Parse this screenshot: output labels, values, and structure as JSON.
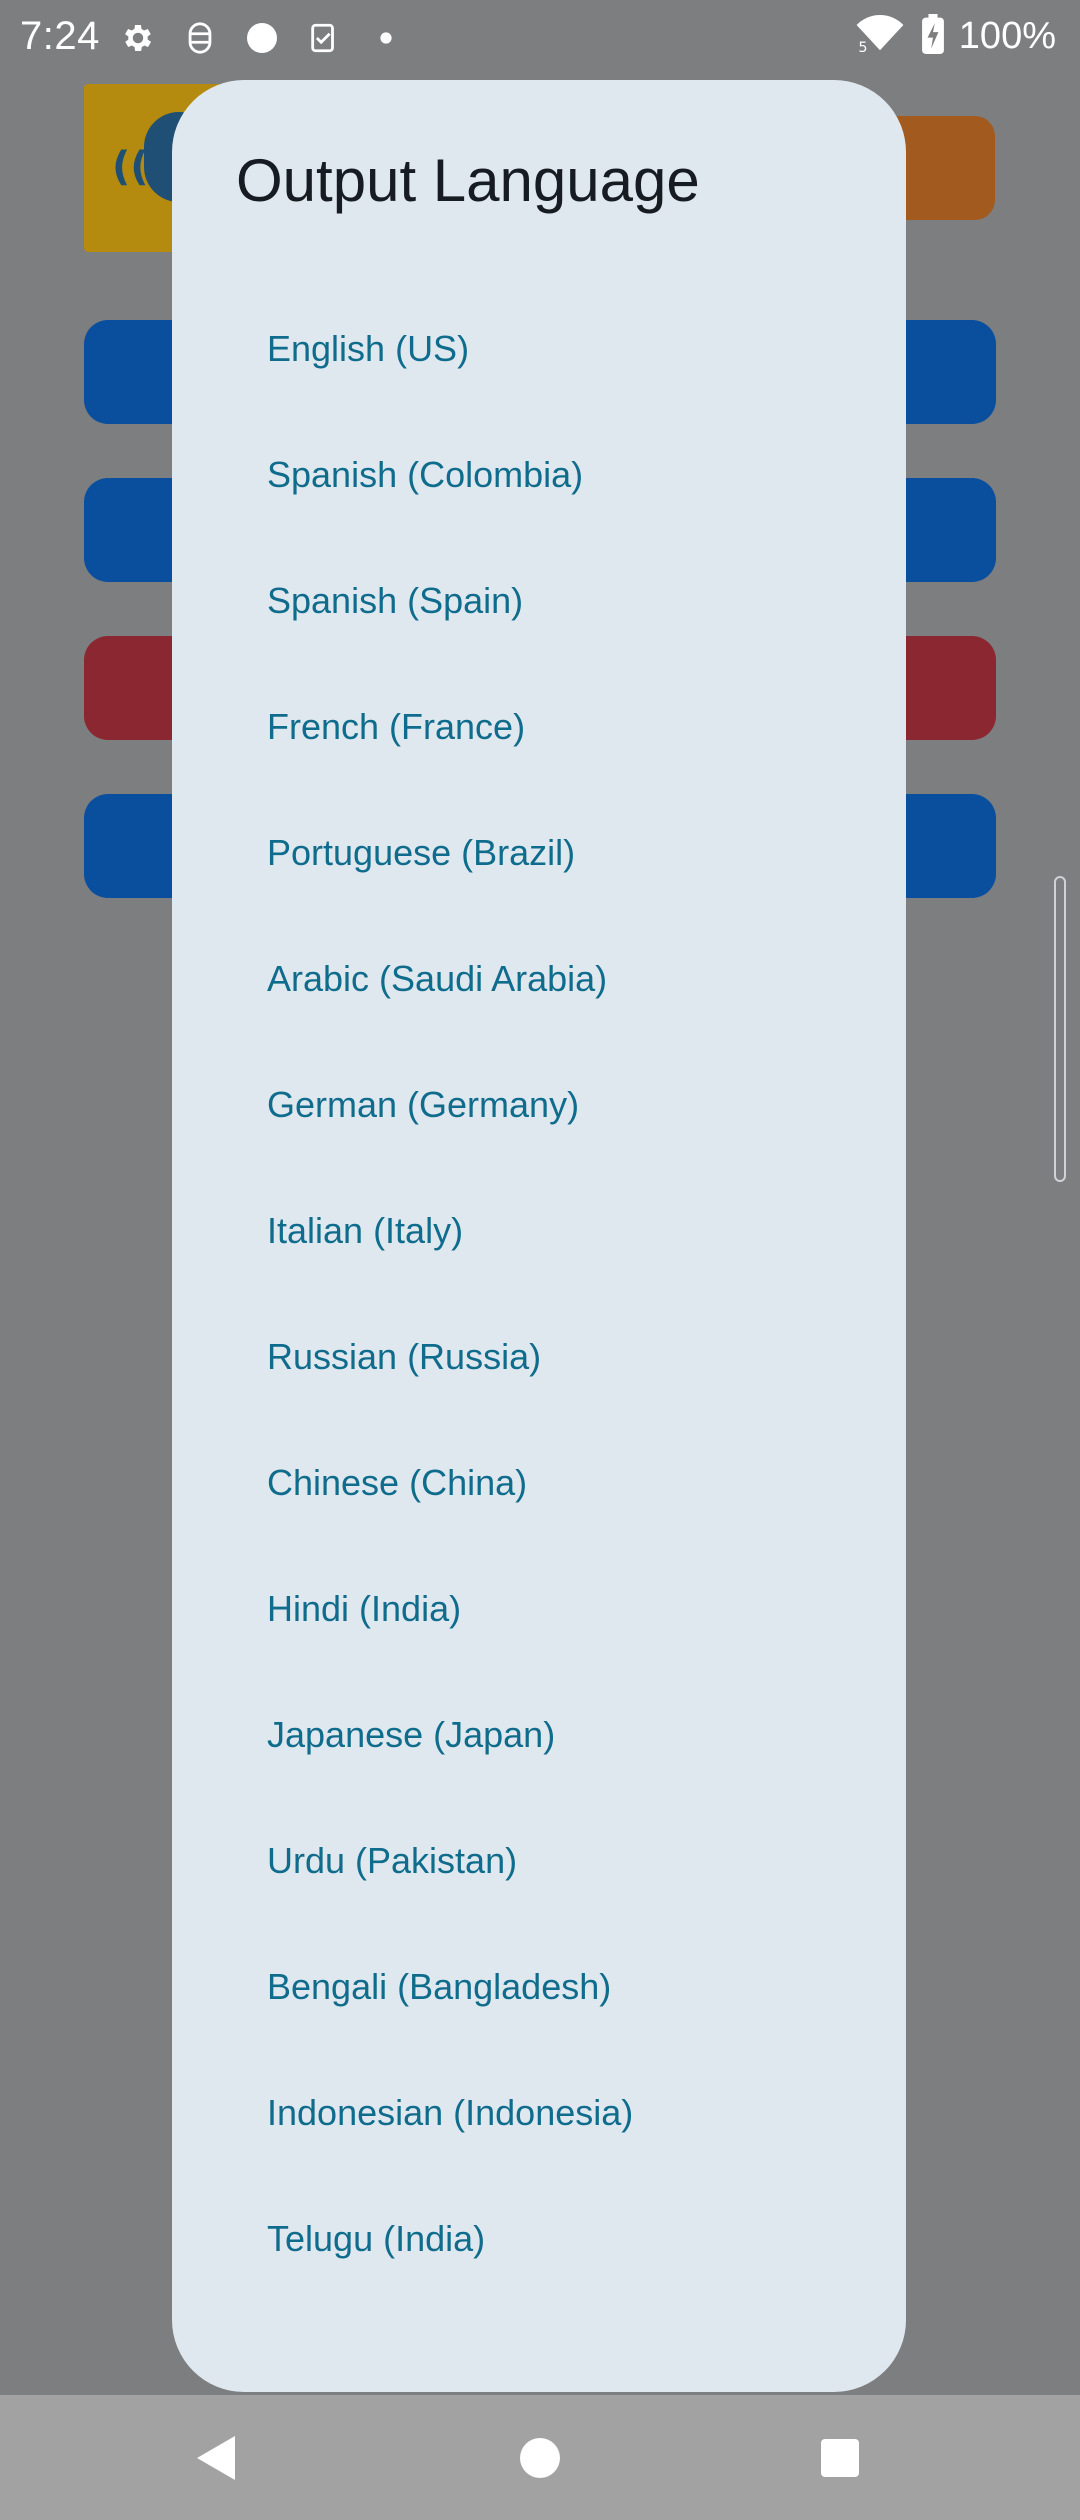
{
  "status_bar": {
    "time": "7:24",
    "battery_text": "100%",
    "left_icons": [
      "settings-icon",
      "accessibility-icon",
      "circle-icon",
      "clipboard-check-icon",
      "dot-icon"
    ],
    "right_icons": [
      "wifi-icon",
      "battery-charging-icon"
    ],
    "wifi_badge": "5"
  },
  "dialog": {
    "title": "Output Language",
    "languages": [
      "English (US)",
      "Spanish (Colombia)",
      "Spanish (Spain)",
      "French (France)",
      "Portuguese (Brazil)",
      "Arabic (Saudi Arabia)",
      "German (Germany)",
      "Italian (Italy)",
      "Russian (Russia)",
      "Chinese (China)",
      "Hindi (India)",
      "Japanese (Japan)",
      "Urdu (Pakistan)",
      "Bengali (Bangladesh)",
      "Indonesian (Indonesia)",
      "Telugu (India)"
    ]
  },
  "colors": {
    "dialog_background": "#e0e8ef",
    "item_text": "#0f6c8c",
    "title_text": "#161c21",
    "scrim": "#7d7e80",
    "bg_blue_button": "#0a4e9e",
    "bg_red_button": "#8a2730",
    "bg_orange_button": "#a35a1f",
    "bg_logo": "#b48a0f"
  },
  "nav_bar": {
    "buttons": [
      "back-icon",
      "home-icon",
      "recents-icon"
    ]
  }
}
